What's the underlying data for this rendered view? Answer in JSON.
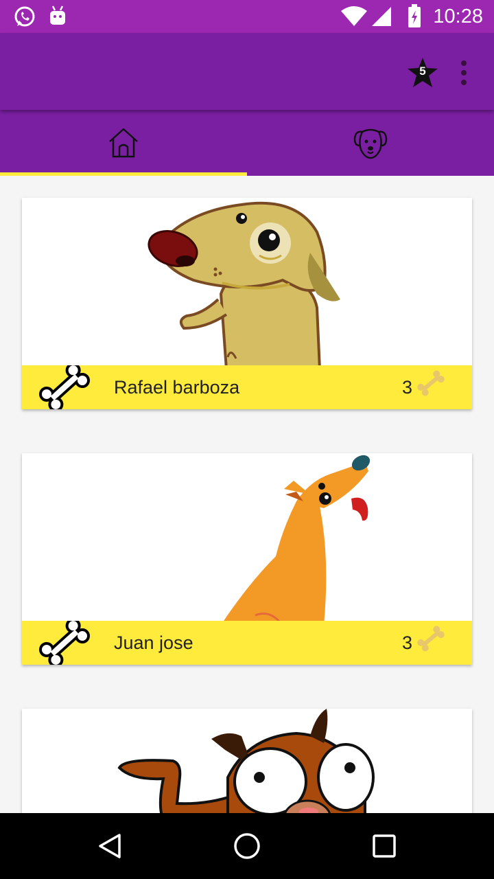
{
  "status_bar": {
    "time": "10:28",
    "icons": [
      "whatsapp-icon",
      "android-icon",
      "wifi-icon",
      "signal-icon",
      "battery-icon"
    ]
  },
  "app_bar": {
    "star_badge_count": "5",
    "actions": [
      "star-badge-icon",
      "overflow-menu-icon"
    ]
  },
  "tabs": [
    {
      "name": "home",
      "icon": "home-icon",
      "selected": true
    },
    {
      "name": "dogs",
      "icon": "dog-face-icon",
      "selected": false
    }
  ],
  "colors": {
    "status_bar": "#9c27b0",
    "app_bar": "#7b1fa2",
    "tab_indicator": "#ffeb3b",
    "card_footer": "#ffeb3b"
  },
  "cards": [
    {
      "owner": "Rafael barboza",
      "bones": "3",
      "image": "tan-dog-illustration"
    },
    {
      "owner": "Juan jose",
      "bones": "3",
      "image": "orange-dog-illustration"
    },
    {
      "owner": "",
      "bones": "",
      "image": "brown-dog-illustration"
    }
  ],
  "nav_bar": {
    "buttons": [
      "back-icon",
      "home-circle-icon",
      "recents-icon"
    ]
  }
}
